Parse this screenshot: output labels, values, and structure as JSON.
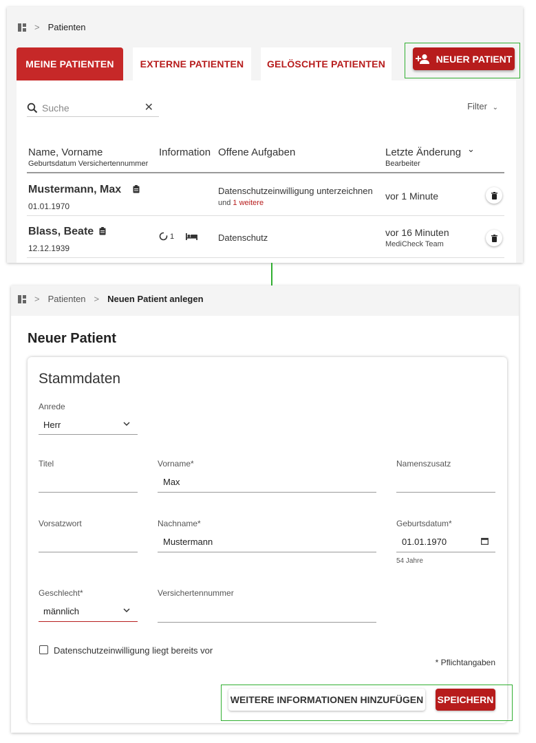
{
  "list_view": {
    "breadcrumb": {
      "current": "Patienten"
    },
    "tabs": [
      {
        "label": "MEINE PATIENTEN",
        "active": true
      },
      {
        "label": "EXTERNE PATIENTEN",
        "active": false
      },
      {
        "label": "GELÖSCHTE PATIENTEN",
        "active": false
      }
    ],
    "new_patient_button": "NEUER PATIENT",
    "search": {
      "placeholder": "Suche"
    },
    "filter_label": "Filter",
    "columns": {
      "name": "Name, Vorname",
      "name_sub": "Geburtsdatum Versichertennummer",
      "information": "Information",
      "tasks": "Offene Aufgaben",
      "changed": "Letzte Änderung",
      "changed_sub": "Bearbeiter"
    },
    "rows": [
      {
        "name": "Mustermann, Max",
        "birthdate": "01.01.1970",
        "info_count": "",
        "task": "Datenschutzeinwilligung unterzeichnen",
        "task_more_prefix": "und",
        "task_more_link": "1 weitere",
        "changed": "vor 1 Minute",
        "editor": ""
      },
      {
        "name": "Blass, Beate",
        "birthdate": "12.12.1939",
        "info_count": "1",
        "task": "Datenschutz",
        "task_more_prefix": "",
        "task_more_link": "",
        "changed": "vor 16 Minuten",
        "editor": "MediCheck Team"
      }
    ]
  },
  "form_view": {
    "breadcrumb": {
      "parent": "Patienten",
      "current": "Neuen Patient anlegen"
    },
    "page_title": "Neuer Patient",
    "section_title": "Stammdaten",
    "fields": {
      "anrede": {
        "label": "Anrede",
        "value": "Herr"
      },
      "titel": {
        "label": "Titel",
        "value": ""
      },
      "vorname": {
        "label": "Vorname*",
        "value": "Max"
      },
      "namenszusatz": {
        "label": "Namenszusatz",
        "value": ""
      },
      "vorsatzwort": {
        "label": "Vorsatzwort",
        "value": ""
      },
      "nachname": {
        "label": "Nachname*",
        "value": "Mustermann"
      },
      "geburtsdatum": {
        "label": "Geburtsdatum*",
        "value": "01.01.1970",
        "hint": "54 Jahre"
      },
      "geschlecht": {
        "label": "Geschlecht*",
        "value": "männlich"
      },
      "versichertennummer": {
        "label": "Versichertennummer",
        "value": ""
      }
    },
    "consent_checkbox": {
      "label": "Datenschutzeinwilligung liegt bereits vor",
      "checked": false
    },
    "required_note": "* Pflichtangaben",
    "more_info_button": "WEITERE INFORMATIONEN HINZUFÜGEN",
    "save_button": "SPEICHERN"
  },
  "colors": {
    "primary": "#b71c1c",
    "active_tab": "#c62828",
    "highlight": "#2fae2f"
  }
}
